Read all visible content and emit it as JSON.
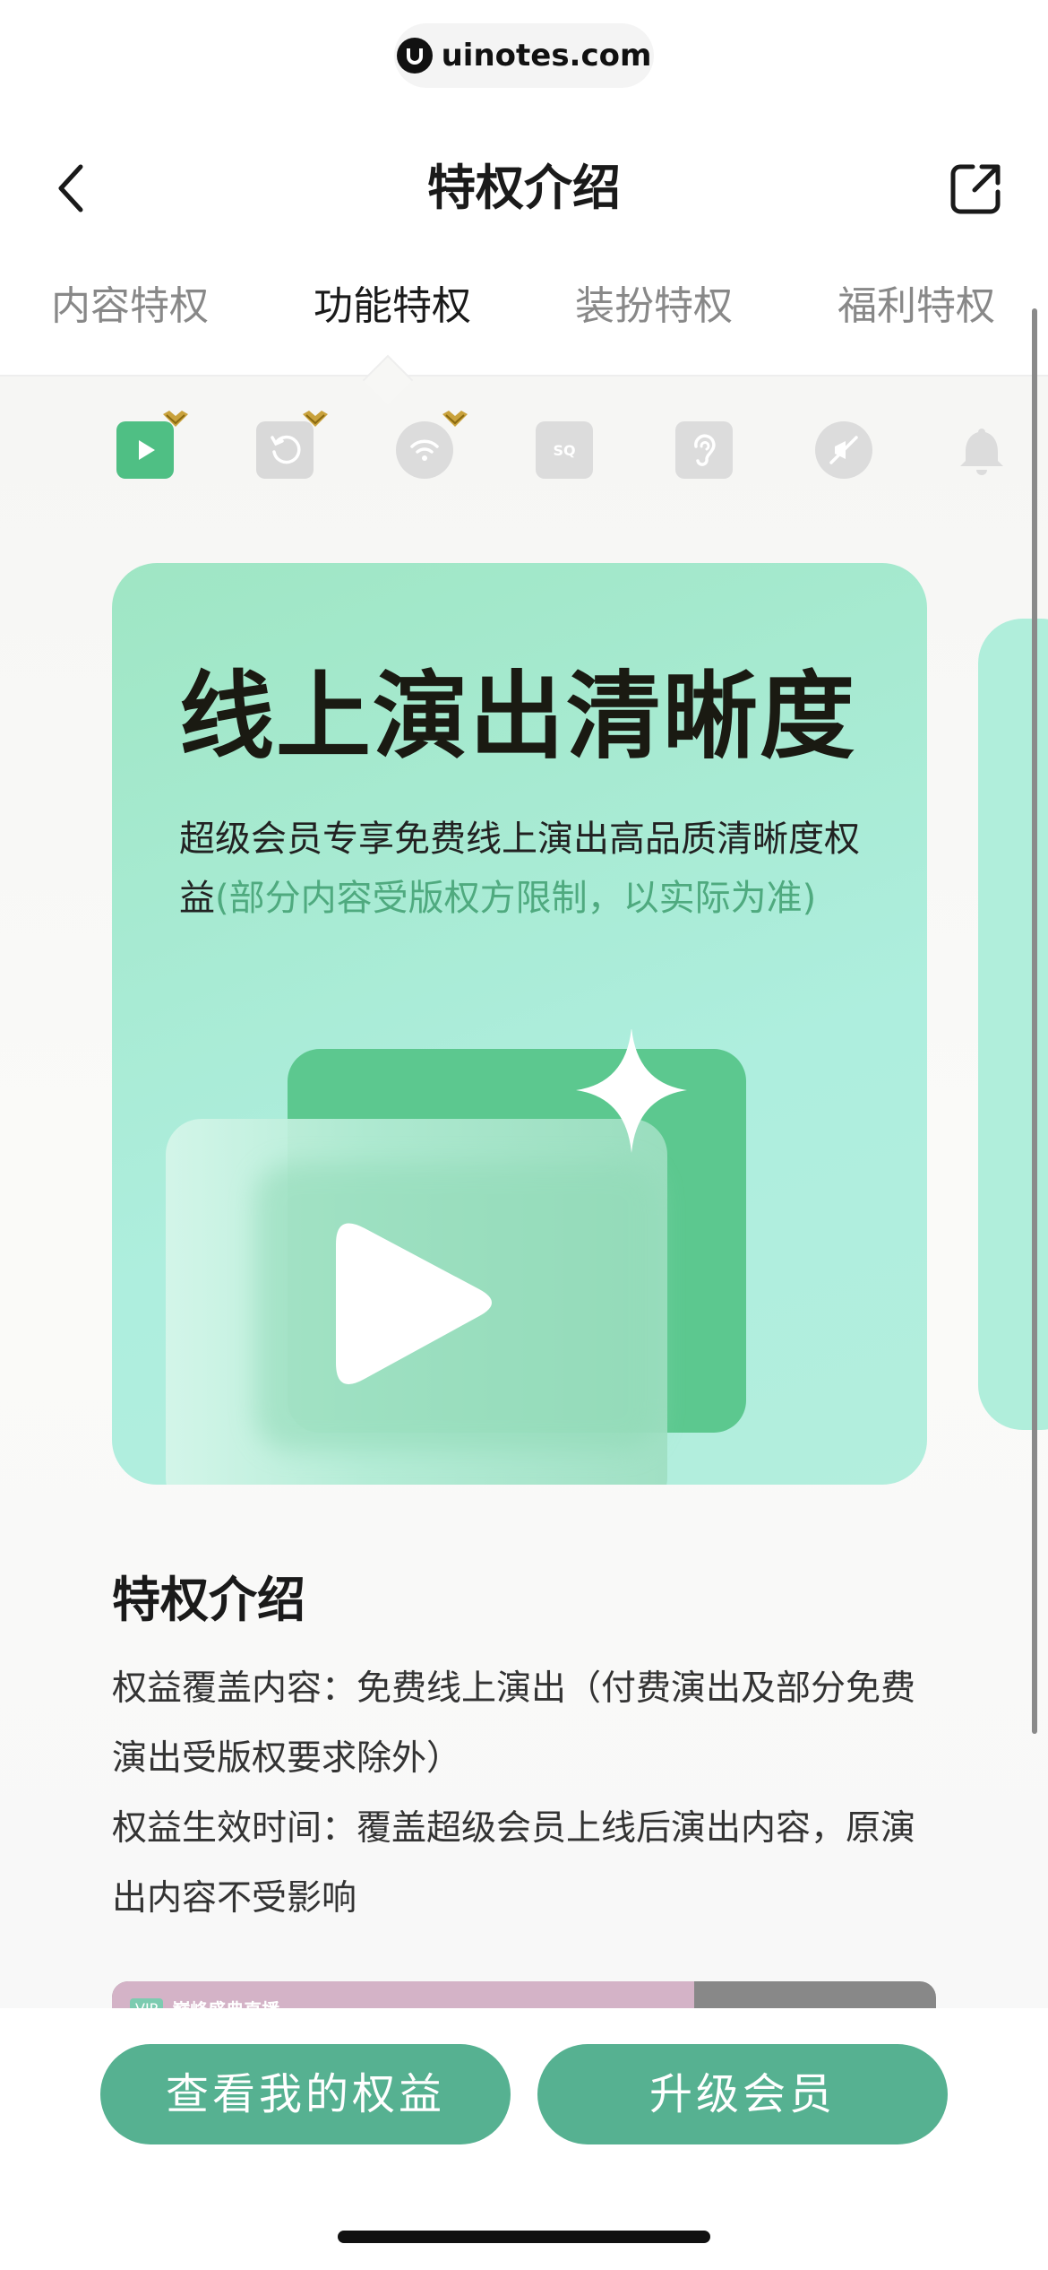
{
  "watermark": {
    "text": "uinotes.com"
  },
  "navbar": {
    "title": "特权介绍",
    "back_icon": "chevron-left-icon",
    "share_icon": "share-external-icon"
  },
  "tabs": [
    {
      "label": "内容特权",
      "active": false
    },
    {
      "label": "功能特权",
      "active": true
    },
    {
      "label": "装扮特权",
      "active": false
    },
    {
      "label": "福利特权",
      "active": false
    }
  ],
  "privilege_icons": [
    {
      "name": "online-show-icon",
      "active": true,
      "crown": true
    },
    {
      "name": "replay-icon",
      "active": false,
      "crown": true
    },
    {
      "name": "wifi-icon",
      "active": false,
      "crown": true
    },
    {
      "name": "sq-quality-icon",
      "active": false,
      "crown": false
    },
    {
      "name": "ear-icon",
      "active": false,
      "crown": false
    },
    {
      "name": "no-ads-icon",
      "active": false,
      "crown": false
    },
    {
      "name": "bell-icon",
      "active": false,
      "crown": false
    }
  ],
  "card": {
    "title": "线上演出清晰度",
    "desc_main": "超级会员专享免费线上演出高品质清晰度权益",
    "desc_note": "(部分内容受版权方限制，以实际为准)"
  },
  "section": {
    "title": "特权介绍",
    "lines": [
      "权益覆盖内容：免费线上演出（付费演出及部分免费演出受版权要求除外）",
      "权益生效时间：覆盖超级会员上线后演出内容，原演出内容不受影响"
    ]
  },
  "preview": {
    "tag": "VIP",
    "text": "巅峰盛典直播"
  },
  "buttons": {
    "view_benefits": "查看我的权益",
    "upgrade": "升级会员"
  },
  "colors": {
    "accent": "#56b191",
    "card_bg": "#a9ecd4",
    "note": "#4faa7f"
  }
}
